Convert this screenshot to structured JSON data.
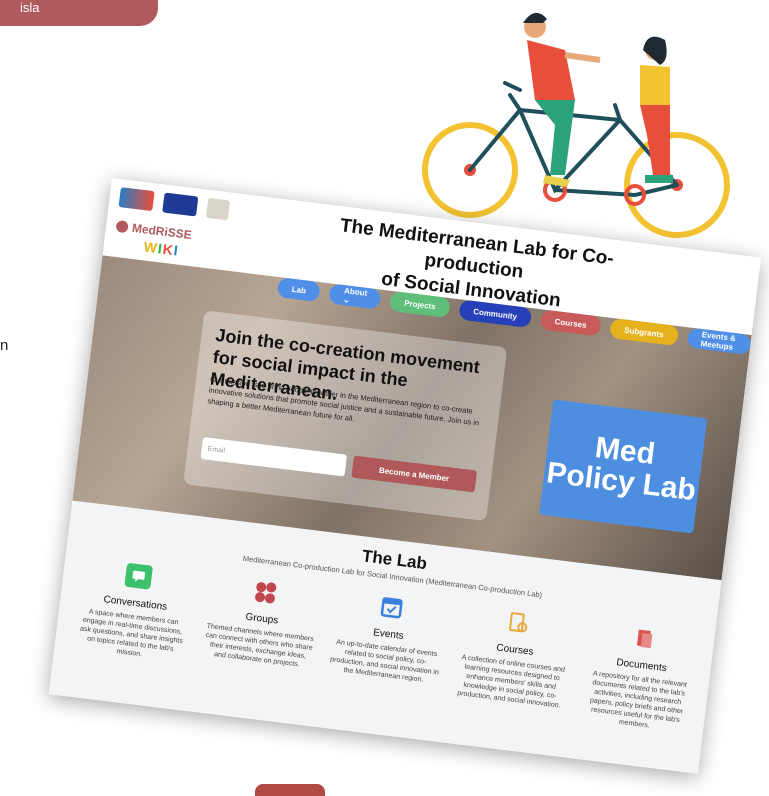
{
  "tab_label": "isla",
  "edge_text": "n",
  "site": {
    "logo_text": "MedRiSSE",
    "wiki": [
      "W",
      "I",
      "K",
      "I"
    ],
    "title_line1": "The Mediterranean Lab for Co-production",
    "title_line2": "of Social Innovation"
  },
  "nav": [
    {
      "label": "Lab",
      "color": "blue"
    },
    {
      "label": "About ⌄",
      "color": "blue"
    },
    {
      "label": "Projects",
      "color": "green"
    },
    {
      "label": "Community",
      "color": "navy"
    },
    {
      "label": "Courses",
      "color": "red"
    },
    {
      "label": "Subgrants",
      "color": "yellow"
    },
    {
      "label": "Events & Meetups",
      "color": "blue"
    }
  ],
  "hero": {
    "heading": "Join the co-creation movement for social impact in the Mediterranean.",
    "text": "Our mission is to bring people together in the Mediterranean region to co-create innovative solutions that promote social justice and a sustainable future. Join us in shaping a better Mediterranean future for all.",
    "email_placeholder": "Email",
    "cta": "Become a Member",
    "policy_lab": "Med Policy Lab"
  },
  "lab": {
    "title": "The Lab",
    "subtitle": "Mediterranean Co-production Lab for Social Innovation (Mediterranean Co-production Lab)",
    "features": [
      {
        "title": "Conversations",
        "icon": "chat-icon",
        "color": "#3cc06b",
        "desc": "A space where members can engage in real-time discussions, ask questions, and share insights on topics related to the lab's mission."
      },
      {
        "title": "Groups",
        "icon": "groups-icon",
        "color": "#c0474d",
        "desc": "Themed channels where members can connect with others who share their interests, exchange ideas, and collaborate on projects."
      },
      {
        "title": "Events",
        "icon": "calendar-icon",
        "color": "#3a7fe0",
        "desc": "An up-to-date calendar of events related to social policy, co-production, and social innovation in the Mediterranean region."
      },
      {
        "title": "Courses",
        "icon": "courses-icon",
        "color": "#e8a93a",
        "desc": "A collection of online courses and learning resources designed to enhance members' skills and knowledge in social policy, co-production, and social innovation."
      },
      {
        "title": "Documents",
        "icon": "documents-icon",
        "color": "#d9534f",
        "desc": "A repository for all the relevant documents related to the lab's activities, including research papers, policy briefs and other resources useful for the lab's members."
      }
    ]
  },
  "colors": {
    "accent": "#b05a5e",
    "policy_blue": "#4d8ee0"
  }
}
